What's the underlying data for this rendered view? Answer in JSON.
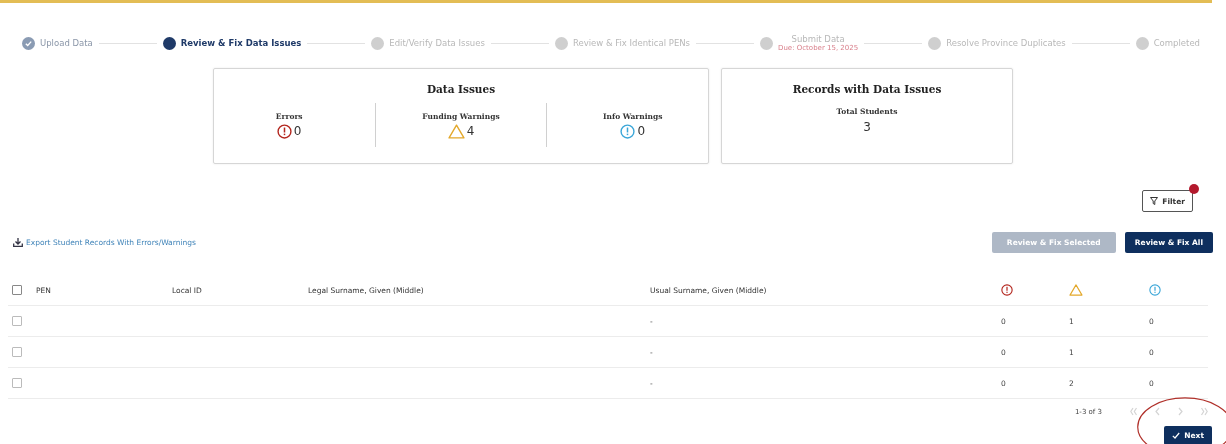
{
  "stepper": {
    "steps": [
      {
        "label": "Upload Data",
        "done": true,
        "selected": false
      },
      {
        "label": "Review & Fix Data Issues",
        "done": false,
        "selected": true
      },
      {
        "label": "Edit/Verify Data Issues",
        "done": false,
        "selected": false
      },
      {
        "label": "Review & Fix Identical PENs",
        "done": false,
        "selected": false
      },
      {
        "label": "Submit Data",
        "done": false,
        "selected": false,
        "due": "Due: October 15, 2025"
      },
      {
        "label": "Resolve Province Duplicates",
        "done": false,
        "selected": false
      },
      {
        "label": "Completed",
        "done": false,
        "selected": false
      }
    ]
  },
  "data_issues": {
    "title": "Data Issues",
    "items": [
      {
        "kind": "error",
        "label": "Errors",
        "count": "0"
      },
      {
        "kind": "warning",
        "label": "Funding Warnings",
        "count": "4"
      },
      {
        "kind": "info",
        "label": "Info Warnings",
        "count": "0"
      }
    ]
  },
  "records": {
    "title": "Records with Data Issues",
    "label": "Total Students",
    "count": "3"
  },
  "filter_button": {
    "label": "Filter"
  },
  "export_link": "Export Student Records With Errors/Warnings",
  "actions": [
    {
      "label": "Review & Fix Selected",
      "disabled": true
    },
    {
      "label": "Review & Fix All",
      "disabled": false
    }
  ],
  "table": {
    "columns": [
      {
        "label": "PEN"
      },
      {
        "label": "Local ID"
      },
      {
        "label": "Legal Surname, Given (Middle)"
      },
      {
        "label": "Usual Surname, Given (Middle)"
      },
      {
        "kind": "error"
      },
      {
        "kind": "warning"
      },
      {
        "kind": "info"
      }
    ],
    "header_checked": false,
    "rows": [
      {
        "checked": false,
        "usual_name": "-",
        "errors": "0",
        "warnings": "1",
        "info": "0"
      },
      {
        "checked": false,
        "usual_name": "-",
        "errors": "0",
        "warnings": "1",
        "info": "0"
      },
      {
        "checked": false,
        "usual_name": "-",
        "errors": "0",
        "warnings": "2",
        "info": "0"
      }
    ]
  },
  "pagination": {
    "range": "1-3 of 3",
    "first_disabled": true,
    "prev_disabled": true,
    "next_disabled": true,
    "last_disabled": true
  },
  "next_button": {
    "label": "Next",
    "circled": true
  }
}
